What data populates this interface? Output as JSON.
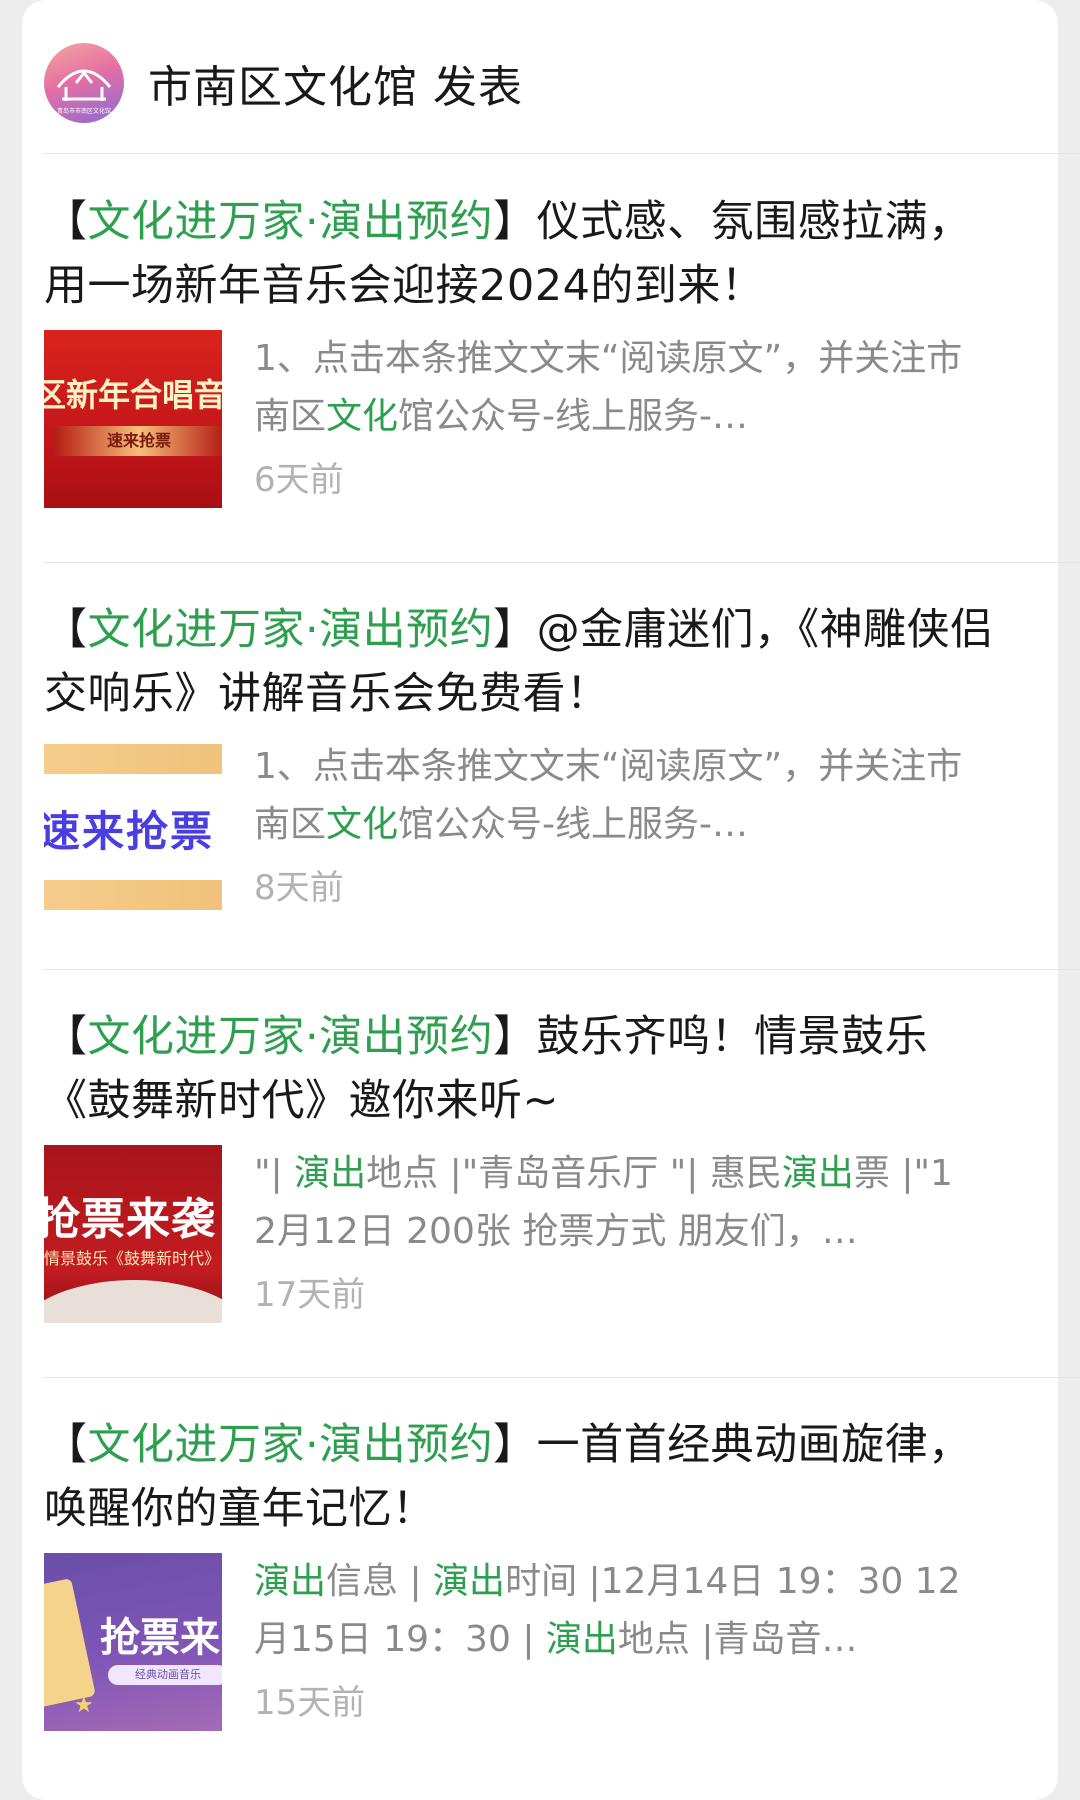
{
  "account": {
    "name": "市南区文化馆 发表",
    "avatar_caption": "青岛市市南区文化馆"
  },
  "articles": [
    {
      "title_prefix_open": "【",
      "title_tag": "文化进万家·演出预约",
      "title_prefix_close": "】",
      "title_rest": "仪式感、氛围感拉满，用一场新年音乐会迎接2024的到来！",
      "digest": [
        {
          "text": "1、点击本条推文文末“阅读原文”，并关注市南区",
          "hl": false
        },
        {
          "text": "文化",
          "hl": true
        },
        {
          "text": "馆公众号-线上服务-…",
          "hl": false
        }
      ],
      "time": "6天前",
      "thumb": {
        "line1": "区新年合唱音",
        "line2": "速来抢票"
      }
    },
    {
      "title_prefix_open": "【",
      "title_tag": "文化进万家·演出预约",
      "title_prefix_close": "】",
      "title_rest": "@金庸迷们，《神雕侠侣交响乐》讲解音乐会免费看！",
      "digest": [
        {
          "text": "1、点击本条推文文末“阅读原文”，并关注市南区",
          "hl": false
        },
        {
          "text": "文化",
          "hl": true
        },
        {
          "text": "馆公众号-线上服务-…",
          "hl": false
        }
      ],
      "time": "8天前",
      "thumb": {
        "line1": "速来抢票"
      }
    },
    {
      "title_prefix_open": "【",
      "title_tag": "文化进万家·演出预约",
      "title_prefix_close": "】",
      "title_rest": "鼓乐齐鸣！情景鼓乐《鼓舞新时代》邀你来听~",
      "digest": [
        {
          "text": "\"| ",
          "hl": false
        },
        {
          "text": "演出",
          "hl": true
        },
        {
          "text": "地点 |\"青岛音乐厅 \"| 惠民",
          "hl": false
        },
        {
          "text": "演出",
          "hl": true
        },
        {
          "text": "票 |\"12月12日 200张 抢票方式 朋友们，…",
          "hl": false
        }
      ],
      "time": "17天前",
      "thumb": {
        "line1": "抢票来袭",
        "line2": "情景鼓乐《鼓舞新时代》"
      }
    },
    {
      "title_prefix_open": "【",
      "title_tag": "文化进万家·演出预约",
      "title_prefix_close": "】",
      "title_rest": "一首首经典动画旋律，唤醒你的童年记忆！",
      "digest": [
        {
          "text": "演出",
          "hl": true
        },
        {
          "text": "信息 | ",
          "hl": false
        },
        {
          "text": "演出",
          "hl": true
        },
        {
          "text": "时间 |12月14日 19：30 12月15日 19：30 | ",
          "hl": false
        },
        {
          "text": "演出",
          "hl": true
        },
        {
          "text": "地点 |青岛音…",
          "hl": false
        }
      ],
      "time": "15天前",
      "thumb": {
        "line1": "抢票来",
        "line2": "经典动画音乐"
      }
    }
  ]
}
